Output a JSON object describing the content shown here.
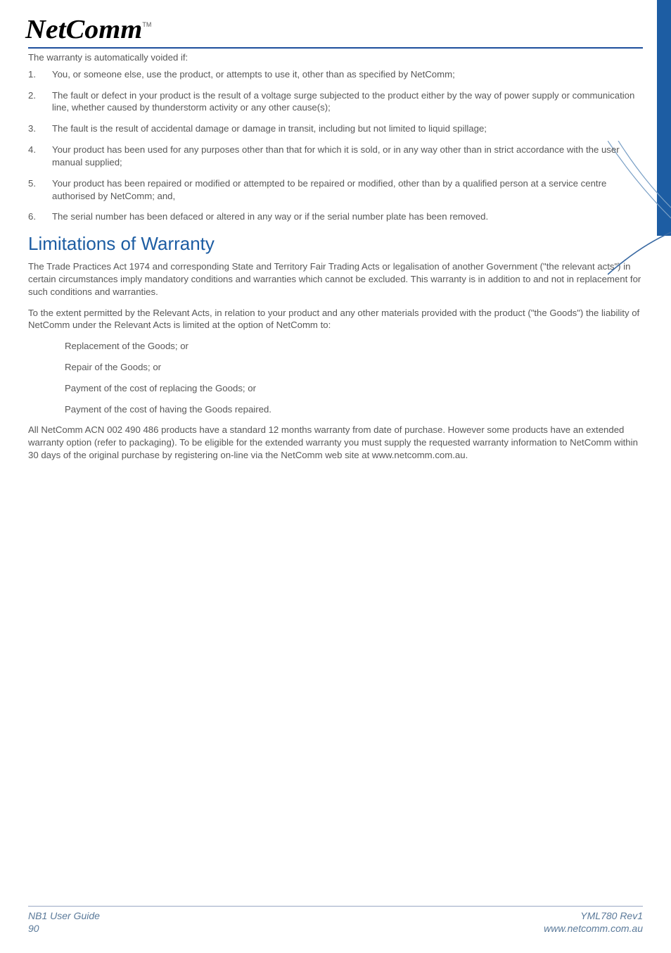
{
  "logo": {
    "brand": "NetComm",
    "tm": "TM"
  },
  "intro": "The warranty is automatically voided if:",
  "voided": [
    "You, or someone else, use the product, or attempts to use it, other than as specified by NetComm;",
    "The fault or defect in your product is the result of a voltage surge subjected to the product either by the way of power supply or communication line, whether caused by thunderstorm activity or any other cause(s);",
    "The fault is the result of accidental damage or damage in transit, including but not limited to liquid spillage;",
    "Your product has been used for any purposes other than that for which it is sold, or in any way other than in strict accordance with the user manual supplied;",
    "Your product has been repaired or modified or attempted to be repaired or modified, other than by a qualified person at a service centre authorised by NetComm; and,",
    "The serial number has been defaced or altered in any way or if the serial number plate has been removed."
  ],
  "section_title": "Limitations of Warranty",
  "para1": "The Trade Practices Act 1974 and corresponding State and Territory Fair Trading Acts or legalisation of another Government (\"the relevant acts\") in certain circumstances imply mandatory conditions and warranties which cannot be excluded. This warranty is in addition to and not in replacement for such conditions and warranties.",
  "para2": "To the extent permitted by the Relevant Acts, in relation to your product and any other materials provided with the product (\"the Goods\") the liability of NetComm under the Relevant Acts is limited at the option of NetComm to:",
  "options": [
    "Replacement of the Goods; or",
    "Repair of the Goods; or",
    "Payment of the cost of replacing the Goods; or",
    "Payment of the cost of having the Goods repaired."
  ],
  "para3": "All NetComm ACN 002 490 486 products have a standard 12 months warranty from date of purchase. However some products have an extended warranty option (refer to packaging). To be eligible for the extended warranty you must supply the requested warranty information to NetComm within 30 days of the original purchase by registering on-line via the NetComm web site at www.netcomm.com.au.",
  "footer": {
    "left_line1": "NB1 User Guide",
    "left_line2": "90",
    "right_line1": "YML780 Rev1",
    "right_line2": "www.netcomm.com.au"
  }
}
